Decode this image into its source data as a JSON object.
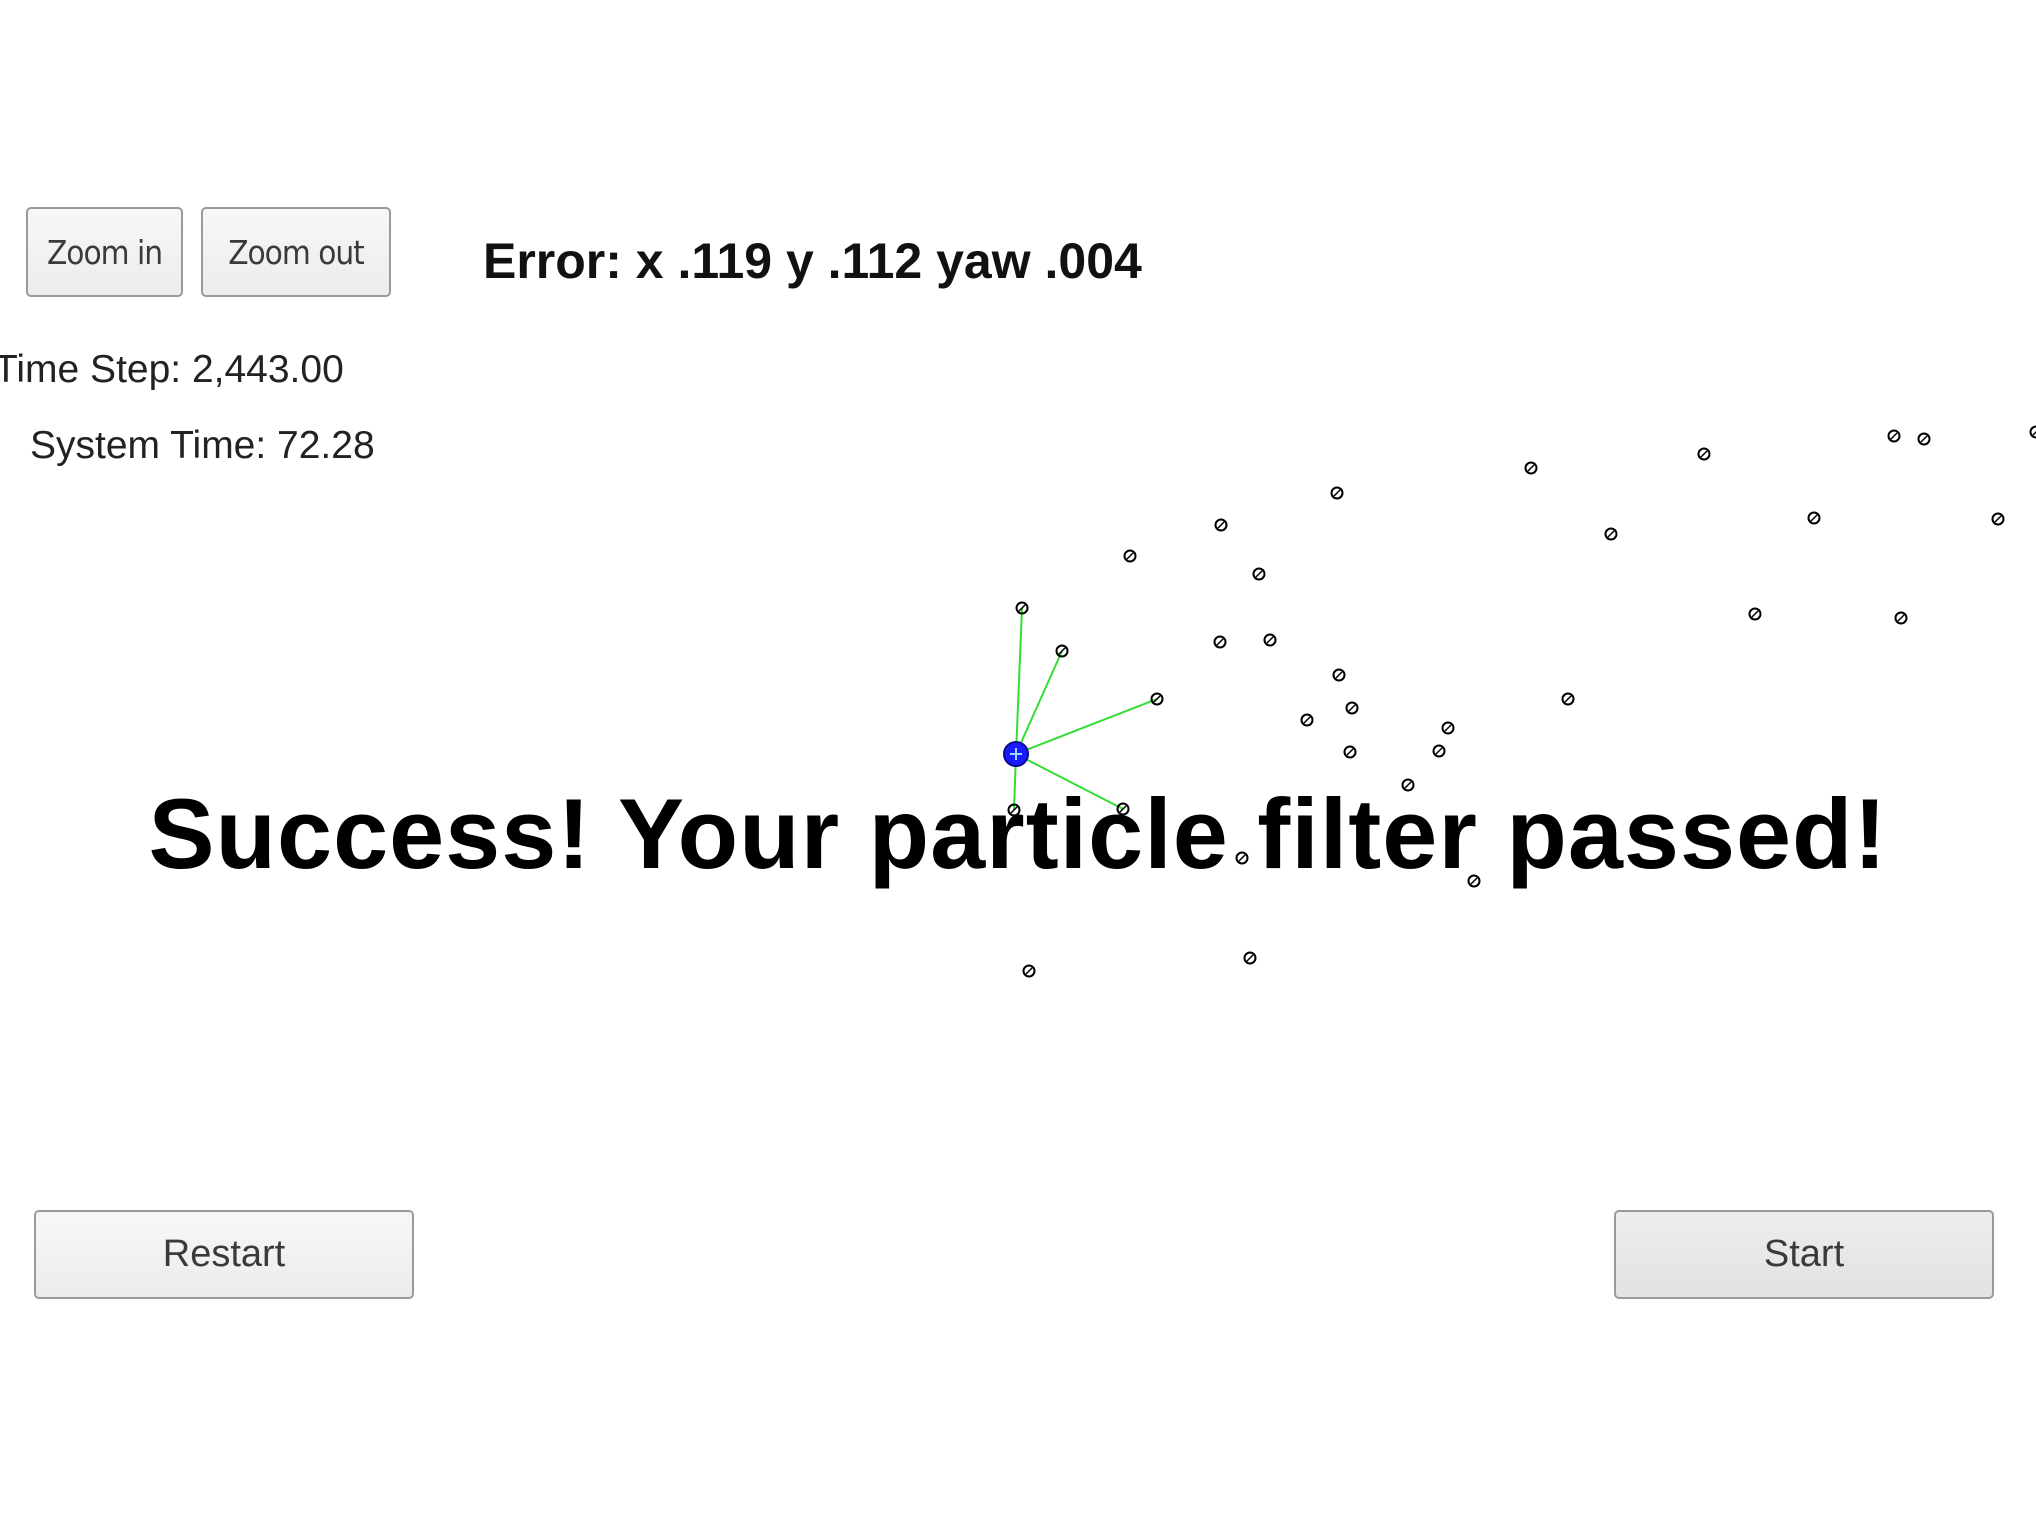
{
  "controls": {
    "zoom_in_label": "Zoom in",
    "zoom_out_label": "Zoom out",
    "restart_label": "Restart",
    "start_label": "Start"
  },
  "status": {
    "error_text": "Error: x .119 y .112 yaw .004",
    "time_step_text": "Time Step: 2,443.00",
    "system_time_text": "System Time: 72.28",
    "success_message": "Success! Your particle filter passed!"
  },
  "colors": {
    "vehicle": "#1a1aff",
    "observation_lines": "#33dd33",
    "landmarks": "#000000"
  },
  "icons": {
    "vehicle": "vehicle-marker-icon",
    "landmark": "landmark-marker-icon"
  }
}
